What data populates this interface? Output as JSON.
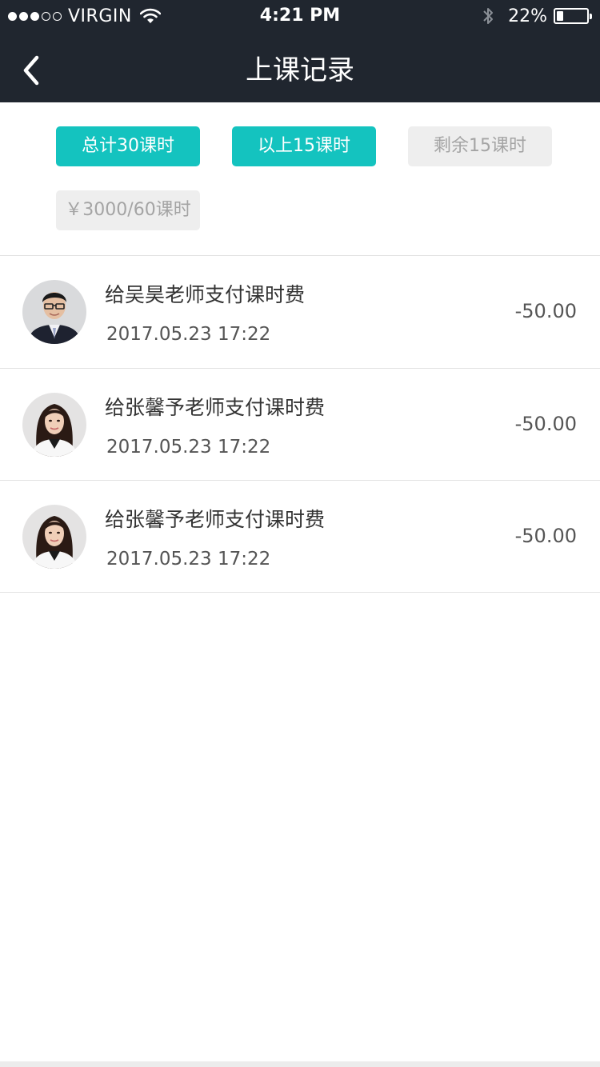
{
  "status_bar": {
    "carrier": "VIRGIN",
    "time": "4:21 PM",
    "battery_percent": "22%",
    "battery_level": 0.22,
    "signal_bars": 3,
    "signal_total": 5,
    "icons": [
      "signal-dots-icon",
      "wifi-icon",
      "bluetooth-icon",
      "battery-icon"
    ]
  },
  "nav": {
    "title": "上课记录",
    "back_icon": "chevron-left-icon"
  },
  "summary_tags": [
    {
      "label": "总计30课时",
      "style": "teal"
    },
    {
      "label": "以上15课时",
      "style": "teal"
    },
    {
      "label": "剩余15课时",
      "style": "gray"
    },
    {
      "label": "￥3000/60课时",
      "style": "gray"
    }
  ],
  "records": [
    {
      "title": "给吴昊老师支付课时费",
      "time": "2017.05.23 17:22",
      "amount": "-50.00",
      "avatar": "male-teacher-avatar"
    },
    {
      "title": "给张馨予老师支付课时费",
      "time": "2017.05.23 17:22",
      "amount": "-50.00",
      "avatar": "female-teacher-avatar"
    },
    {
      "title": "给张馨予老师支付课时费",
      "time": "2017.05.23 17:22",
      "amount": "-50.00",
      "avatar": "female-teacher-avatar"
    }
  ],
  "colors": {
    "header_bg": "#20262f",
    "accent_teal": "#14c3bf",
    "tag_gray_bg": "#eeeeee",
    "tag_gray_text": "#a4a4a4",
    "divider": "#e2e2e2"
  }
}
